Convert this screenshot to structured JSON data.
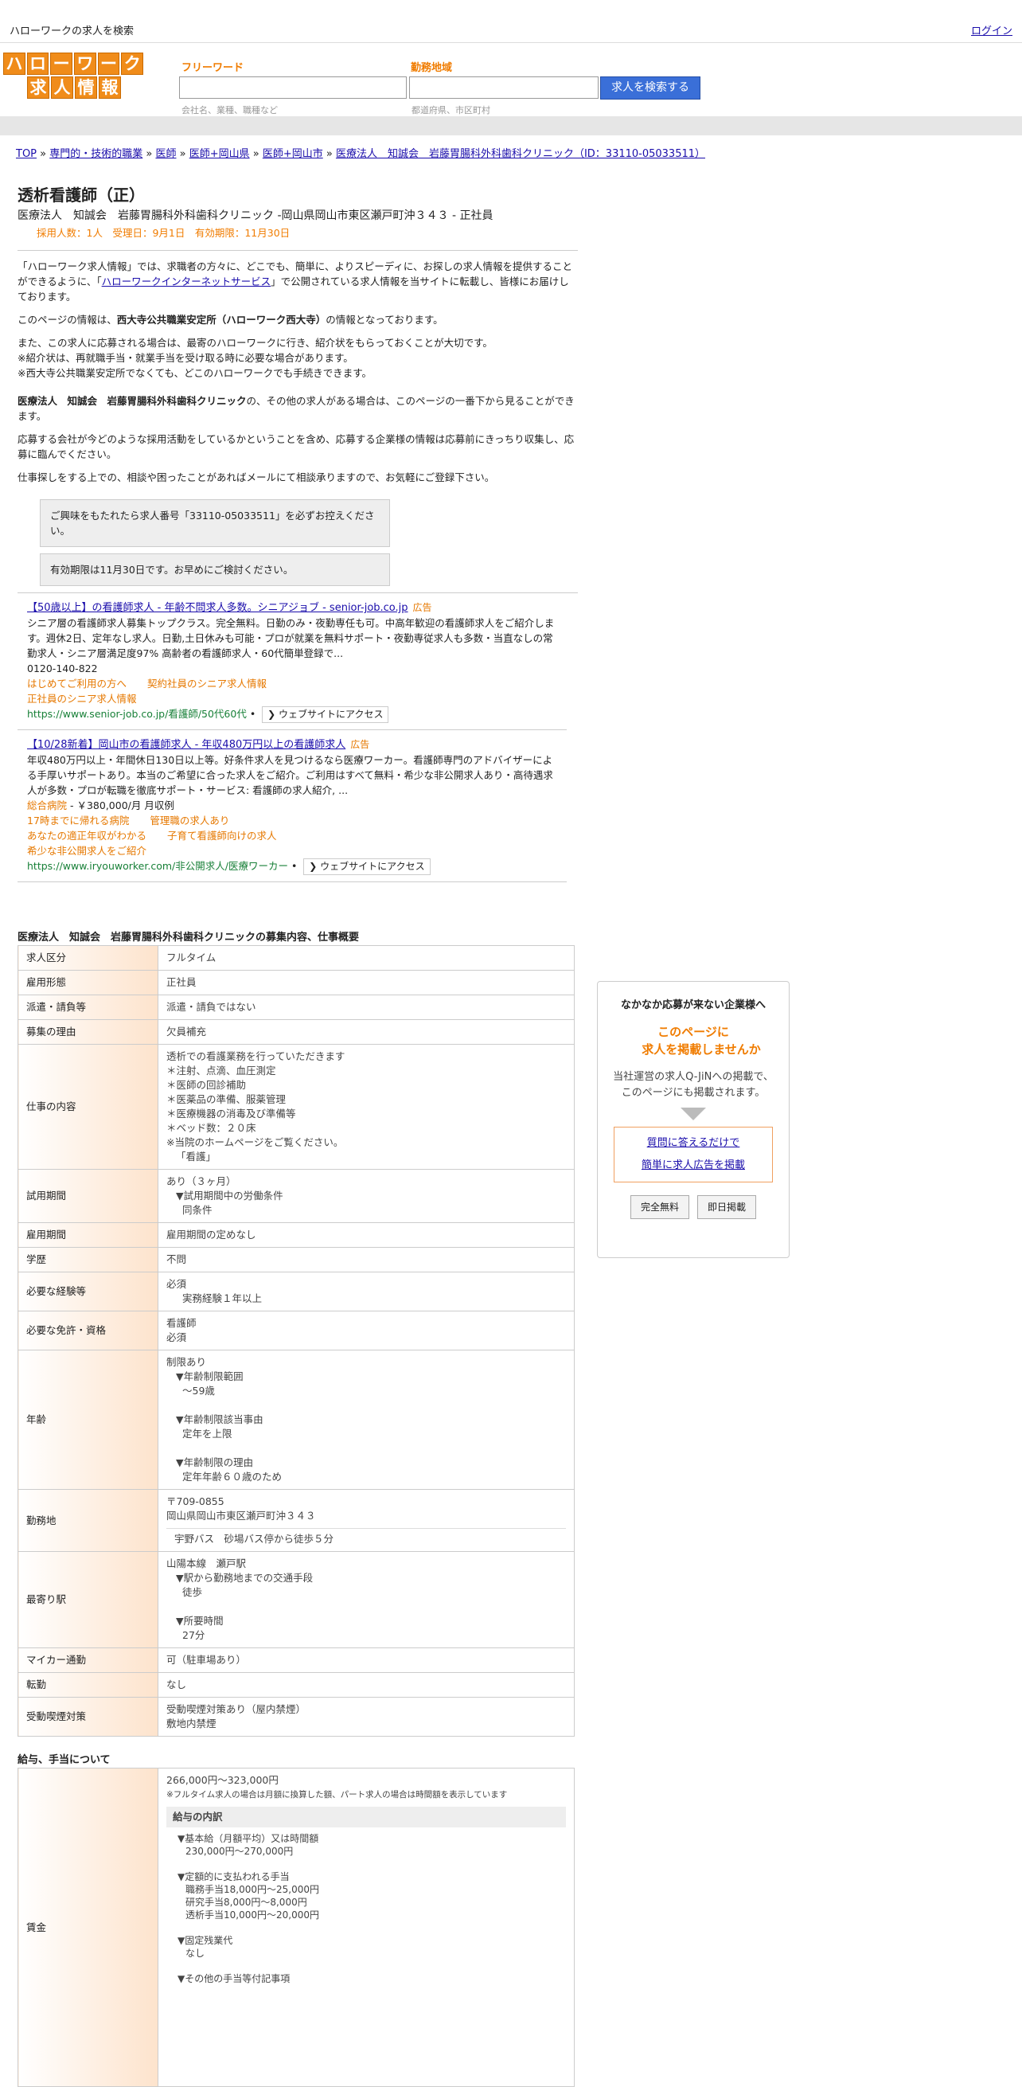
{
  "topbar": {
    "title": "ハローワークの求人を検索",
    "login": "ログイン"
  },
  "logo": {
    "row1": [
      "ハ",
      "ロ",
      "ー",
      "ワ",
      "ー",
      "ク"
    ],
    "row2": [
      "求",
      "人",
      "情",
      "報"
    ]
  },
  "search": {
    "keyword_label": "フリーワード",
    "keyword_hint": "会社名、業種、職種など",
    "area_label": "勤務地域",
    "area_hint": "都道府県、市区町村",
    "button": "求人を検索する"
  },
  "breadcrumb": [
    "TOP",
    "専門的・技術的職業",
    "医師",
    "医師+岡山県",
    "医師+岡山市",
    "医療法人　知誠会　岩藤胃腸科外科歯科クリニック（ID：33110-05033511）"
  ],
  "job": {
    "title": "透析看護師（正）",
    "subtitle": "医療法人　知誠会　岩藤胃腸科外科歯科クリニック -岡山県岡山市東区瀬戸町沖３４３ - 正社員",
    "meta": "採用人数：1人　受理日：9月1日　有効期限：11月30日"
  },
  "intro": {
    "p1a": "「ハローワーク求人情報」では、求職者の方々に、どこでも、簡単に、よりスピーディに、お探しの求人情報を提供することができるように、「",
    "p1link": "ハローワークインターネットサービス",
    "p1b": "」で公開されている求人情報を当サイトに転載し、皆様にお届けしております。",
    "p2a": "このページの情報は、",
    "p2b": "西大寺公共職業安定所（ハローワーク西大寺）",
    "p2c": "の情報となっております。",
    "p3": "また、この求人に応募される場合は、最寄のハローワークに行き、紹介状をもらっておくことが大切です。",
    "p3b": "※紹介状は、再就職手当・就業手当を受け取る時に必要な場合があります。",
    "p3c": "※西大寺公共職業安定所でなくても、どこのハローワークでも手続きできます。",
    "p4a": "医療法人　知誠会　岩藤胃腸科外科歯科クリニック",
    "p4b": "の、その他の求人がある場合は、このページの一番下から見ることができます。",
    "p5": "応募する会社が今どのような採用活動をしているかということを含め、応募する企業様の情報は応募前にきっちり収集し、応募に臨んでください。",
    "p6": "仕事探しをする上での、相談や困ったことがあればメールにて相談承りますので、お気軽にご登録下さい。",
    "box1": "ご興味をもたれたら求人番号「33110-05033511」を必ずお控えください。",
    "box2": "有効期限は11月30日です。お早めにご検討ください。"
  },
  "ads": [
    {
      "title": "【50歳以上】の看護師求人 - 年齢不問求人多数。シニアジョブ - senior-job.co.jp",
      "tag": "広告",
      "desc": "シニア層の看護師求人募集トップクラス。完全無料。日勤のみ・夜勤専任も可。中高年歓迎の看護師求人をご紹介します。週休2日、定年なし求人。日勤,土日休みも可能・プロが就業を無料サポート・夜勤専従求人も多数・当直なしの常勤求人・シニア層満足度97% 高齢者の看護師求人・60代簡単登録で...",
      "phone": "0120-140-822",
      "links": [
        "はじめてご利用の方へ",
        "契約社員のシニア求人情報",
        "正社員のシニア求人情報"
      ],
      "url": "https://www.senior-job.co.jp/看護師/50代60代",
      "visit": "ウェブサイトにアクセス"
    },
    {
      "title": "【10/28新着】岡山市の看護師求人 - 年収480万円以上の看護師求人",
      "tag": "広告",
      "desc": "年収480万円以上・年間休日130日以上等。好条件求人を見つけるなら医療ワーカー。看護師専門のアドバイザーによる手厚いサポートあり。本当のご希望に合った求人をご紹介。ご利用はすべて無料・希少な非公開求人あり・高待遇求人が多数・プロが転職を徹底サポート・サービス: 看護師の求人紹介, ...",
      "salary_link": "総合病院",
      "salary": " - ￥380,000/月 月収例",
      "links": [
        "17時までに帰れる病院",
        "管理職の求人あり",
        "あなたの適正年収がわかる",
        "子育て看護師向けの求人",
        "希少な非公開求人をご紹介"
      ],
      "url": "https://www.iryouworker.com/非公開求人/医療ワーカー",
      "visit": "ウェブサイトにアクセス"
    }
  ],
  "section1_title": "医療法人　知誠会　岩藤胃腸科外科歯科クリニックの募集内容、仕事概要",
  "rows": [
    {
      "k": "求人区分",
      "v": [
        "フルタイム"
      ]
    },
    {
      "k": "雇用形態",
      "v": [
        "正社員"
      ]
    },
    {
      "k": "派遣・請負等",
      "v": [
        "派遣・請負ではない"
      ]
    },
    {
      "k": "募集の理由",
      "v": [
        "欠員補充"
      ]
    },
    {
      "k": "仕事の内容",
      "v": [
        "透析での看護業務を行っていただきます",
        "＊注射、点滴、血圧測定",
        "＊医師の回診補助",
        "＊医薬品の準備、服薬管理",
        "＊医療機器の消毒及び準備等",
        "＊ベッド数：２０床",
        "※当院のホームページをご覧ください。",
        "「看護」"
      ]
    },
    {
      "k": "試用期間",
      "v": [
        "あり（３ヶ月）",
        "▼試用期間中の労働条件",
        "同条件"
      ]
    },
    {
      "k": "雇用期間",
      "v": [
        "雇用期間の定めなし"
      ]
    },
    {
      "k": "学歴",
      "v": [
        "不問"
      ]
    },
    {
      "k": "必要な経験等",
      "v": [
        "必須",
        "実務経験１年以上"
      ]
    },
    {
      "k": "必要な免許・資格",
      "v": [
        "看護師",
        "必須"
      ]
    },
    {
      "k": "年齢",
      "v": [
        "制限あり",
        "▼年齢制限範囲",
        "〜59歳",
        "",
        "▼年齢制限該当事由",
        "定年を上限",
        "",
        "▼年齢制限の理由",
        "定年年齢６０歳のため"
      ]
    },
    {
      "k": "勤務地",
      "v": [
        "〒709-0855",
        "岡山県岡山市東区瀬戸町沖３４３",
        "宇野バス　砂場バス停から徒歩５分"
      ]
    },
    {
      "k": "最寄り駅",
      "v": [
        "山陽本線　瀬戸駅",
        "▼駅から勤務地までの交通手段",
        "徒歩",
        "",
        "▼所要時間",
        "27分"
      ]
    },
    {
      "k": "マイカー通勤",
      "v": [
        "可（駐車場あり）"
      ]
    },
    {
      "k": "転勤",
      "v": [
        "なし"
      ]
    },
    {
      "k": "受動喫煙対策",
      "v": [
        "受動喫煙対策あり（屋内禁煙）",
        "敷地内禁煙"
      ]
    }
  ],
  "section2_title": "給与、手当について",
  "wage": {
    "k": "賃金",
    "range": "266,000円〜323,000円",
    "note": "※フルタイム求人の場合は月額に換算した額、パート求人の場合は時間額を表示しています",
    "breakdown": "給与の内訳",
    "lines": [
      "▼基本給（月額平均）又は時間額",
      "230,000円〜270,000円",
      "",
      "▼定額的に支払われる手当",
      "職務手当18,000円〜25,000円",
      "研究手当8,000円〜8,000円",
      "透析手当10,000円〜20,000円",
      "",
      "▼固定残業代",
      "なし",
      "",
      "▼その他の手当等付記事項"
    ]
  },
  "sidebar": {
    "heading": "なかなか応募が来ない企業様へ",
    "orange1": "このページに",
    "orange2": "求人を掲載しませんか",
    "desc1": "当社運営の求人Q-JiNへの掲載で、",
    "desc2": "このページにも掲載されます。",
    "link1": "質問に答えるだけで",
    "link2": "簡単に求人広告を掲載",
    "btn1": "完全無料",
    "btn2": "即日掲載"
  }
}
